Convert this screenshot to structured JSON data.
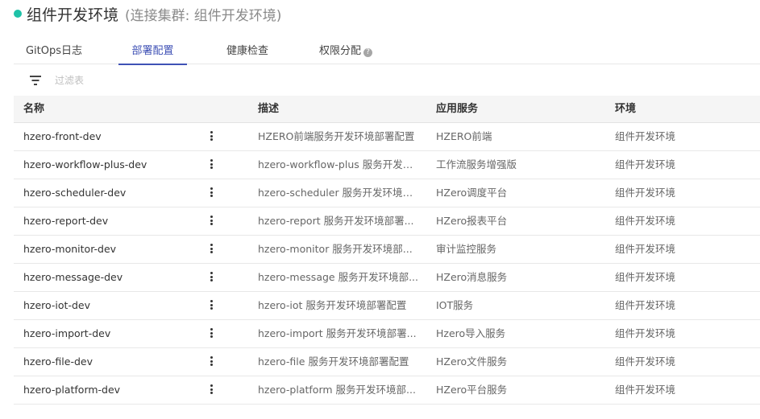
{
  "header": {
    "title": "组件开发环境",
    "cluster_note": "(连接集群: 组件开发环境)",
    "status_color": "#1fc2a8"
  },
  "tabs": [
    {
      "label": "GitOps日志",
      "active": false
    },
    {
      "label": "部署配置",
      "active": true
    },
    {
      "label": "健康检查",
      "active": false
    },
    {
      "label": "权限分配",
      "active": false,
      "help_icon": "question-circle-icon"
    }
  ],
  "filter": {
    "icon": "filter-icon",
    "placeholder": "过滤表"
  },
  "table": {
    "columns": [
      "名称",
      "描述",
      "应用服务",
      "环境"
    ],
    "rows": [
      {
        "name": "hzero-front-dev",
        "desc": "HZERO前端服务开发环境部署配置",
        "app": "HZERO前端",
        "env": "组件开发环境"
      },
      {
        "name": "hzero-workflow-plus-dev",
        "desc": "hzero-workflow-plus 服务开发环...",
        "app": "工作流服务增强版",
        "env": "组件开发环境"
      },
      {
        "name": "hzero-scheduler-dev",
        "desc": "hzero-scheduler 服务开发环境部...",
        "app": "HZero调度平台",
        "env": "组件开发环境"
      },
      {
        "name": "hzero-report-dev",
        "desc": "hzero-report 服务开发环境部署...",
        "app": "HZero报表平台",
        "env": "组件开发环境"
      },
      {
        "name": "hzero-monitor-dev",
        "desc": "hzero-monitor 服务开发环境部...",
        "app": "审计监控服务",
        "env": "组件开发环境"
      },
      {
        "name": "hzero-message-dev",
        "desc": "hzero-message 服务开发环境部...",
        "app": "HZero消息服务",
        "env": "组件开发环境"
      },
      {
        "name": "hzero-iot-dev",
        "desc": "hzero-iot 服务开发环境部署配置",
        "app": "IOT服务",
        "env": "组件开发环境"
      },
      {
        "name": "hzero-import-dev",
        "desc": "hzero-import 服务开发环境部署...",
        "app": "Hzero导入服务",
        "env": "组件开发环境"
      },
      {
        "name": "hzero-file-dev",
        "desc": "hzero-file 服务开发环境部署配置",
        "app": "HZero文件服务",
        "env": "组件开发环境"
      },
      {
        "name": "hzero-platform-dev",
        "desc": "hzero-platform 服务开发环境部...",
        "app": "HZero平台服务",
        "env": "组件开发环境"
      }
    ]
  }
}
